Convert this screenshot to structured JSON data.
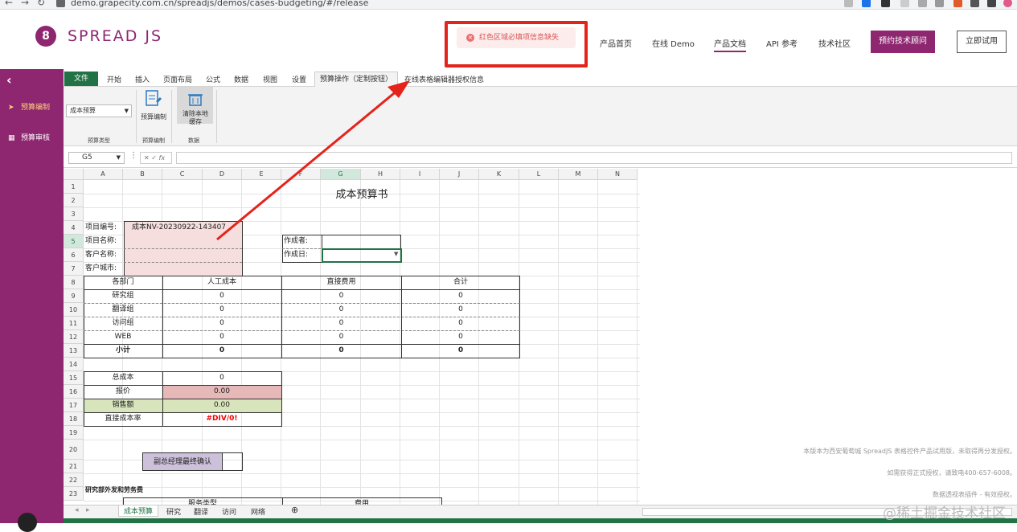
{
  "browser": {
    "url": "demo.grapecity.com.cn/spreadjs/demos/cases-budgeting/#/release"
  },
  "header": {
    "logo_text": "SPREAD JS",
    "toast": "红色区域必填项信息缺失",
    "nav": [
      "产品首页",
      "在线 Demo",
      "产品文档",
      "API 参考",
      "技术社区"
    ],
    "consult_button": "预约技术顾问",
    "trial_button": "立即试用"
  },
  "sidebar": {
    "items": [
      {
        "label": "预算编制",
        "icon": "send-icon"
      },
      {
        "label": "预算审核",
        "icon": "grid-icon"
      }
    ]
  },
  "ribbon": {
    "tabs": [
      "文件",
      "开始",
      "插入",
      "页面布局",
      "公式",
      "数据",
      "视图",
      "设置",
      "预算操作（定制按钮）",
      "在线表格编辑器授权信息"
    ],
    "budget_type_value": "成本预算",
    "budget_type_group": "预算类型",
    "budget_edit_button": "预算编制",
    "budget_edit_group": "预算编制",
    "clear_cache_line1": "清除本地",
    "clear_cache_line2": "缓存",
    "data_group": "数据"
  },
  "formula_bar": {
    "name_box": "G5",
    "fx": "fx"
  },
  "grid": {
    "columns": [
      "A",
      "B",
      "C",
      "D",
      "E",
      "F",
      "G",
      "H",
      "I",
      "J",
      "K",
      "L",
      "M",
      "N"
    ],
    "rows": [
      "1",
      "2",
      "3",
      "4",
      "5",
      "6",
      "7",
      "8",
      "9",
      "10",
      "11",
      "12",
      "13",
      "14",
      "15",
      "16",
      "17",
      "18",
      "19",
      "20",
      "21",
      "22",
      "23"
    ],
    "title": "成本预算书",
    "project_no_label": "项目编号:",
    "project_no_value": "成本NV-20230922-143407",
    "project_name_label": "项目名称:",
    "customer_name_label": "客户名称:",
    "customer_city_label": "客户城市:",
    "author_label": "作成者:",
    "date_label": "作成日:",
    "table1": {
      "headers": [
        "各部门",
        "人工成本",
        "直接费用",
        "合计"
      ],
      "rows": [
        [
          "研究组",
          "0",
          "0",
          "0"
        ],
        [
          "翻译组",
          "0",
          "0",
          "0"
        ],
        [
          "访问组",
          "0",
          "0",
          "0"
        ],
        [
          "WEB",
          "0",
          "0",
          "0"
        ],
        [
          "小计",
          "0",
          "0",
          "0"
        ]
      ]
    },
    "summary": [
      {
        "label": "总成本",
        "value": "0"
      },
      {
        "label": "报价",
        "value": "0.00"
      },
      {
        "label": "销售额",
        "value": "0.00"
      },
      {
        "label": "直接成本率",
        "value": "#DIV/0!"
      }
    ],
    "approval_label": "副总经理最终确认",
    "section_title": "研究部外发和劳务费",
    "service_type": "服务类型",
    "fee": "费用",
    "watermark_lines": [
      "本版本为西安葡萄城 SpreadJS 表格控件产品试用版，未取得再分发授权。",
      "如需获得正式授权，请致电400-657-6008。",
      "数据透视表插件 - 有效授权。"
    ]
  },
  "sheet_tabs": [
    "成本预算",
    "研究",
    "翻译",
    "访问",
    "网络"
  ],
  "footer_watermark": "@稀土掘金技术社区",
  "colors": {
    "brand": "#8e2670",
    "excel_green": "#217346",
    "annotation_red": "#e4231b"
  }
}
